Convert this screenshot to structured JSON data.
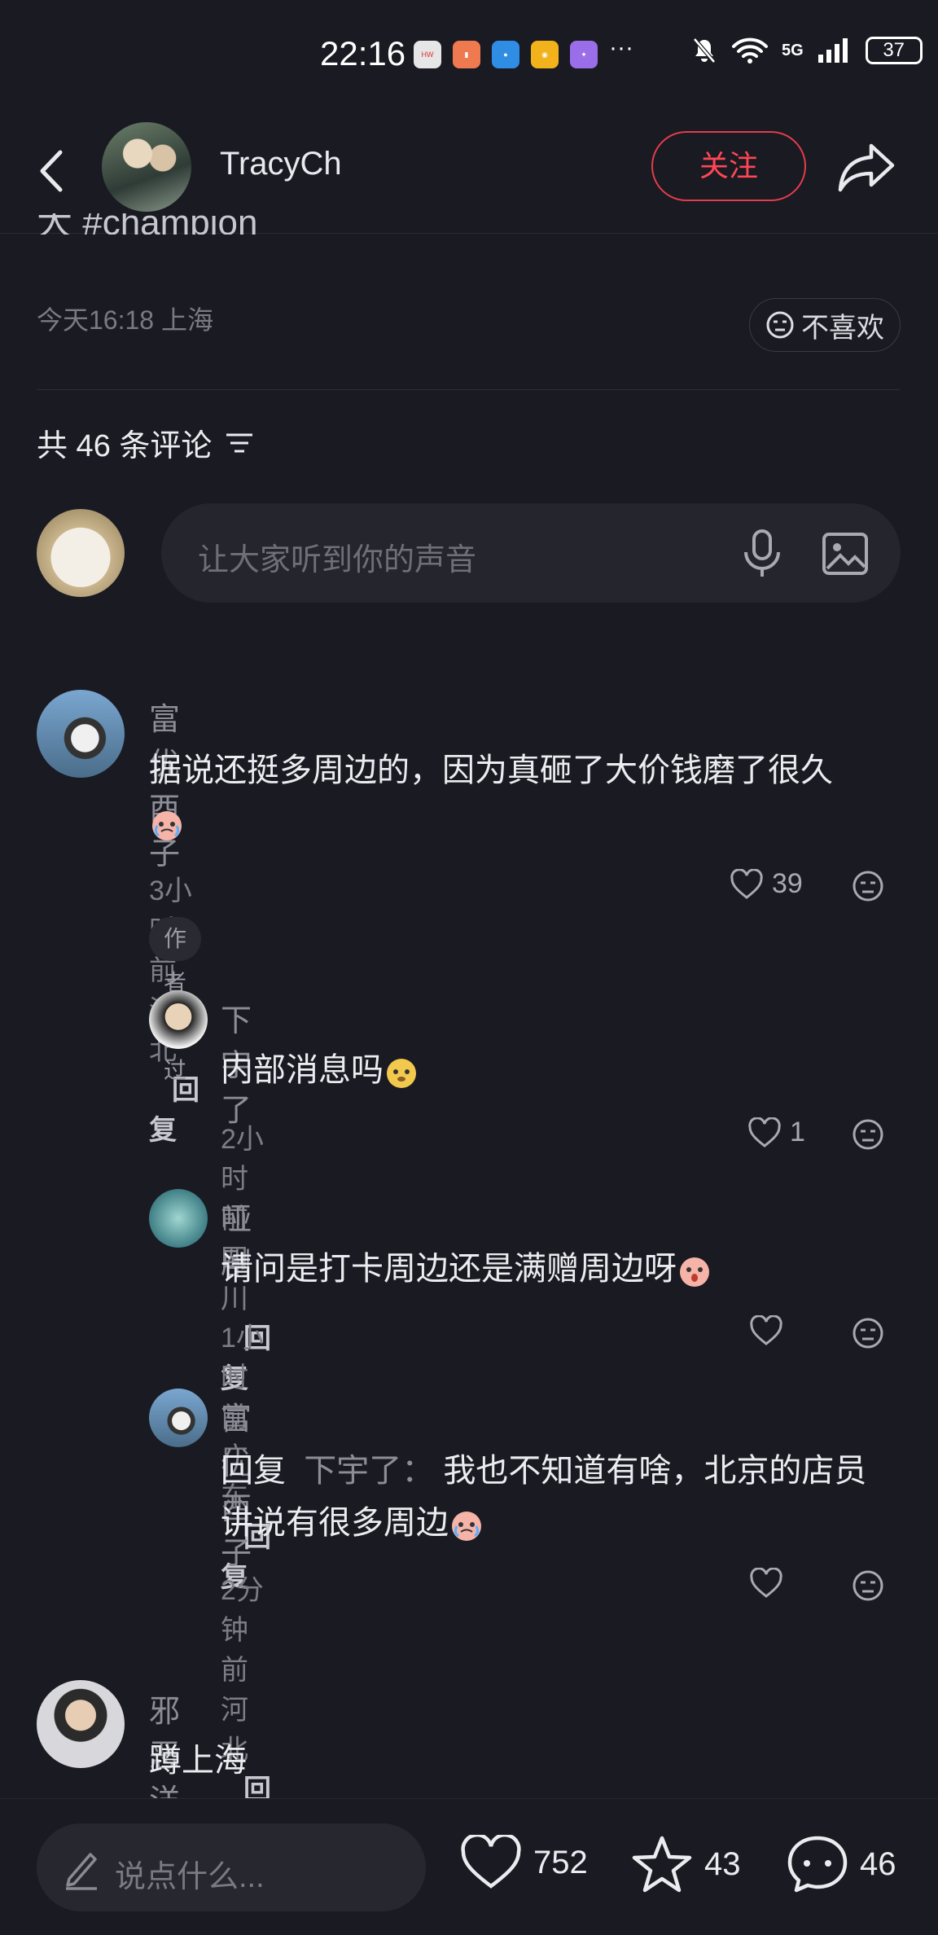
{
  "status_bar": {
    "time": "22:16",
    "more": "···",
    "battery": "37",
    "network": "5G"
  },
  "header": {
    "author": "TracyCh",
    "follow_label": "关注"
  },
  "post": {
    "cut_text": "大 #champion",
    "meta": "今天16:18 上海",
    "dislike_label": "不喜欢"
  },
  "comments_header": {
    "count_label": "共 46 条评论"
  },
  "comment_input": {
    "placeholder": "让大家听到你的声音"
  },
  "comments": [
    {
      "user": "富优酉子",
      "text": "据说还挺多周边的，因为真砸了大价钱磨了很久",
      "meta": "3小时前 河北",
      "reply": "回复",
      "likes": "39",
      "badge": "作者赞过"
    },
    {
      "user": "下宇了",
      "text": "内部消息吗",
      "meta": "2小时前 四川",
      "reply": "回复",
      "likes": "1"
    },
    {
      "user": "哑剧",
      "text": "请问是打卡周边还是满赠周边呀",
      "meta": "1小时前 广东",
      "reply": "回复",
      "likes": ""
    },
    {
      "user": "富优酉子",
      "reply_prefix": "回复",
      "reply_to": "下宇了：",
      "text": "我也不知道有啥，北京的店员讲说有很多周边",
      "meta": "2分钟前 河北",
      "reply": "回复",
      "likes": ""
    },
    {
      "user": "邪恶洋葱头",
      "text": "蹲上海"
    }
  ],
  "bottom_bar": {
    "say_placeholder": "说点什么...",
    "likes": "752",
    "stars": "43",
    "comments": "46"
  },
  "colors": {
    "background": "#1a1a22",
    "accent": "#ff4655"
  }
}
